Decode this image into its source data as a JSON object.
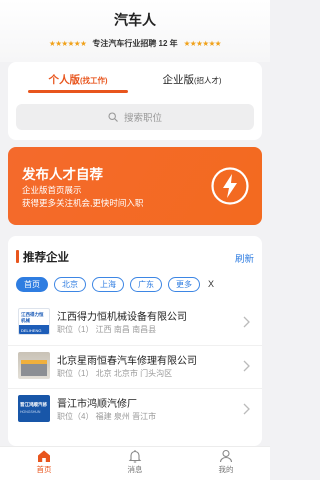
{
  "header": {
    "title": "汽车人",
    "stars_left": "★★★★★★",
    "tagline": "专注汽车行业招聘 12 年",
    "stars_right": "★★★★★★"
  },
  "tabs": [
    {
      "label": "个人版",
      "sub": "(找工作)",
      "active": true
    },
    {
      "label": "企业版",
      "sub": "(招人才)",
      "active": false
    }
  ],
  "search": {
    "placeholder": "搜索职位"
  },
  "banner": {
    "title": "发布人才自荐",
    "line1": "企业版首页展示",
    "line2": "获得更多关注机会,更快时间入职",
    "icon": "bolt-icon",
    "color": "#f36a1f"
  },
  "recommended": {
    "title": "推荐企业",
    "refresh_label": "刷新",
    "filters": [
      "首页",
      "北京",
      "上海",
      "广东",
      "更多"
    ],
    "clear_label": "X",
    "companies": [
      {
        "name": "江西得力恒机械设备有限公司",
        "meta": "职位（1）  江西 南昌 南昌县",
        "logo_text": "江西得力恒机械",
        "logo_sub": "DELIHENG"
      },
      {
        "name": "北京星雨恒春汽车修理有限公司",
        "meta": "职位（1）  北京 北京市 门头沟区",
        "logo_text": "",
        "logo_sub": ""
      },
      {
        "name": "晋江市鸿顺汽修厂",
        "meta": "职位（4）  福建 泉州 晋江市",
        "logo_text": "晋江鸿顺汽修",
        "logo_sub": "HONGSHUN"
      }
    ]
  },
  "nav": [
    {
      "label": "首页",
      "icon": "home-icon",
      "active": true
    },
    {
      "label": "消息",
      "icon": "bell-icon",
      "active": false
    },
    {
      "label": "我的",
      "icon": "user-icon",
      "active": false
    }
  ],
  "colors": {
    "accent": "#e8551d",
    "link": "#2f7de1",
    "star": "#f0a11a"
  }
}
